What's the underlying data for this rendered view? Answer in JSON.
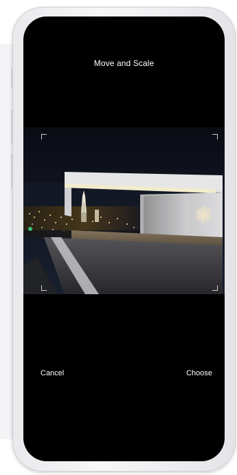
{
  "editor": {
    "title": "Move and Scale",
    "cancel_label": "Cancel",
    "choose_label": "Choose"
  },
  "colors": {
    "screen_background": "#000000",
    "text": "#ffffff",
    "device_frame": "#eeeef1"
  }
}
